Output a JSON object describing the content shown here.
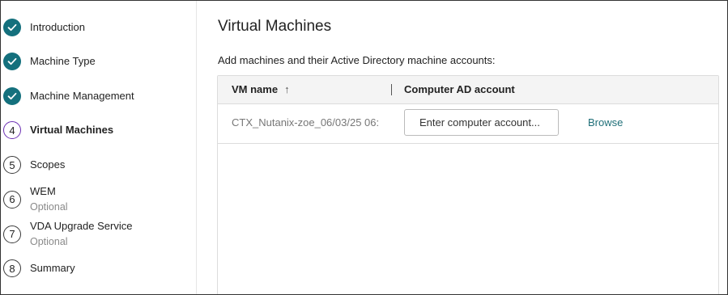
{
  "sidebar": {
    "steps": [
      {
        "label": "Introduction",
        "status": "done"
      },
      {
        "label": "Machine Type",
        "status": "done"
      },
      {
        "label": "Machine Management",
        "status": "done"
      },
      {
        "number": "4",
        "label": "Virtual Machines",
        "status": "current"
      },
      {
        "number": "5",
        "label": "Scopes",
        "status": "pending"
      },
      {
        "number": "6",
        "label": "WEM",
        "sub": "Optional",
        "status": "pending"
      },
      {
        "number": "7",
        "label": "VDA Upgrade Service",
        "sub": "Optional",
        "status": "pending"
      },
      {
        "number": "8",
        "label": "Summary",
        "status": "pending"
      }
    ]
  },
  "main": {
    "title": "Virtual Machines",
    "description": "Add machines and their Active Directory machine accounts:",
    "table": {
      "columns": [
        {
          "label": "VM name",
          "sort": "↑"
        },
        {
          "label": "Computer AD account"
        }
      ],
      "rows": [
        {
          "vm_name": "CTX_Nutanix-zoe_06/03/25 06:",
          "ad_account_value": "",
          "ad_account_placeholder": "Enter computer account...",
          "browse_label": "Browse"
        }
      ]
    }
  },
  "colors": {
    "done": "#14707d",
    "current_ring": "#6b2fb3",
    "link": "#1f6f78"
  }
}
